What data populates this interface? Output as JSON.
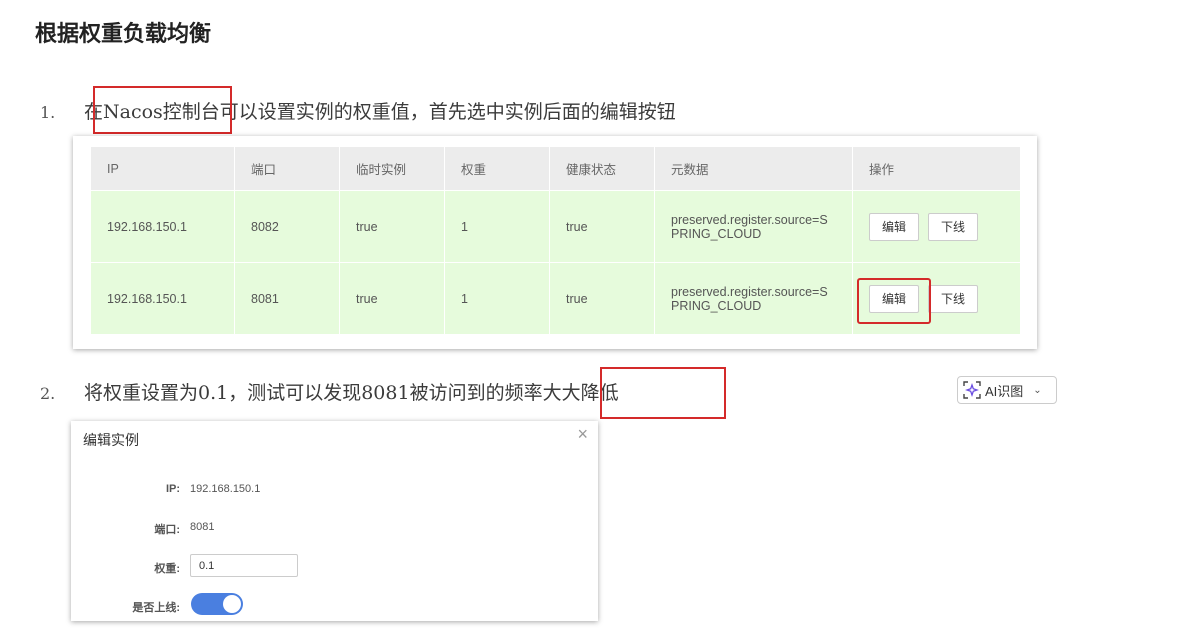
{
  "heading": "根据权重负载均衡",
  "steps": [
    {
      "num": "1.",
      "text": "在Nacos控制台可以设置实例的权重值，首先选中实例后面的编辑按钮"
    },
    {
      "num": "2.",
      "text": "将权重设置为0.1，测试可以发现8081被访问到的频率大大降低"
    }
  ],
  "instance_table": {
    "headers": [
      "IP",
      "端口",
      "临时实例",
      "权重",
      "健康状态",
      "元数据",
      "操作"
    ],
    "rows": [
      {
        "ip": "192.168.150.1",
        "port": "8082",
        "ephemeral": "true",
        "weight": "1",
        "healthy": "true",
        "meta1": "preserved.register.source=S",
        "meta2": "PRING_CLOUD",
        "edit": "编辑",
        "offline": "下线"
      },
      {
        "ip": "192.168.150.1",
        "port": "8081",
        "ephemeral": "true",
        "weight": "1",
        "healthy": "true",
        "meta1": "preserved.register.source=S",
        "meta2": "PRING_CLOUD",
        "edit": "编辑",
        "offline": "下线"
      }
    ]
  },
  "dialog": {
    "title": "编辑实例",
    "close": "×",
    "ip_label": "IP:",
    "ip_value": "192.168.150.1",
    "port_label": "端口:",
    "port_value": "8081",
    "weight_label": "权重:",
    "weight_value": "0.1",
    "online_label": "是否上线:",
    "online_on": true
  },
  "ai_button": {
    "label": "AI识图",
    "chevron": "⌄"
  },
  "colors": {
    "highlight_border": "#d42a2a",
    "row_bg": "#e6fbdc",
    "toggle_on": "#4a7fe0"
  },
  "icons": [
    "sparkle-scan-icon",
    "close-icon",
    "chevron-down-icon"
  ]
}
